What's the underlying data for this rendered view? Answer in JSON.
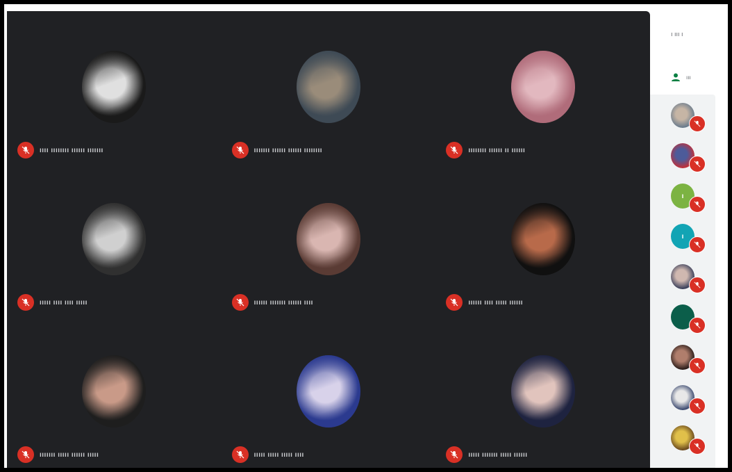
{
  "grid": {
    "tiles": [
      {
        "name": "ıııı ıııııııı ıııııı ııııııı",
        "palette": [
          "#1a1a1a",
          "#e0e0e0"
        ]
      },
      {
        "name": "ııııııı ıııııı ıııııı ıııııııı",
        "palette": [
          "#3e4a55",
          "#9a8c7a"
        ]
      },
      {
        "name": "ıııııııı ıııııı ıı ıııııı",
        "palette": [
          "#b06c7a",
          "#e2b8bf"
        ]
      },
      {
        "name": "ııııı ıııı ıııı ııııı",
        "palette": [
          "#303030",
          "#d0d0d0"
        ]
      },
      {
        "name": "ıııııı ııııııı ıııııı ıııı",
        "palette": [
          "#5a3b34",
          "#d9b6b1"
        ]
      },
      {
        "name": "ıııııı ıııı ııııı ıııııı",
        "palette": [
          "#101010",
          "#b86a4a"
        ]
      },
      {
        "name": "ııııııı ııııı ıııııı ııııı",
        "palette": [
          "#1e1e1e",
          "#c99a88"
        ]
      },
      {
        "name": "ııııı ııııı ııııı ıııı",
        "palette": [
          "#2b3a8f",
          "#d8d2ea"
        ]
      },
      {
        "name": "ııııı ııııııı ııııı ıııııı",
        "palette": [
          "#1e2340",
          "#e1c4bd"
        ]
      }
    ]
  },
  "panel": {
    "header": "ı ııı ı",
    "subheader": "ııı",
    "participants": [
      {
        "palette": [
          "#6a7b8c",
          "#c6b5a5"
        ],
        "letter": ""
      },
      {
        "palette": [
          "#c0303a",
          "#4d5b9a"
        ],
        "letter": ""
      },
      {
        "palette": [
          "#7cb342",
          "#7cb342"
        ],
        "letter": "ı"
      },
      {
        "palette": [
          "#12a4b4",
          "#12a4b4"
        ],
        "letter": "ı"
      },
      {
        "palette": [
          "#3a3f5a",
          "#d0b8b0"
        ],
        "letter": ""
      },
      {
        "palette": [
          "#0b5e4a",
          "#0b5e4a"
        ],
        "letter": ""
      },
      {
        "palette": [
          "#2b1d1a",
          "#b07e6c"
        ],
        "letter": ""
      },
      {
        "palette": [
          "#3c4a70",
          "#e8e8e8"
        ],
        "letter": ""
      },
      {
        "palette": [
          "#6b4a1e",
          "#e0c04a"
        ],
        "letter": ""
      }
    ]
  },
  "colors": {
    "mic_off": "#d93025",
    "grid_bg": "#202124",
    "panel_list_bg": "#f1f3f4"
  },
  "icons": {
    "tile_mic": "mic-off-icon",
    "panel_sub": "person-icon"
  }
}
